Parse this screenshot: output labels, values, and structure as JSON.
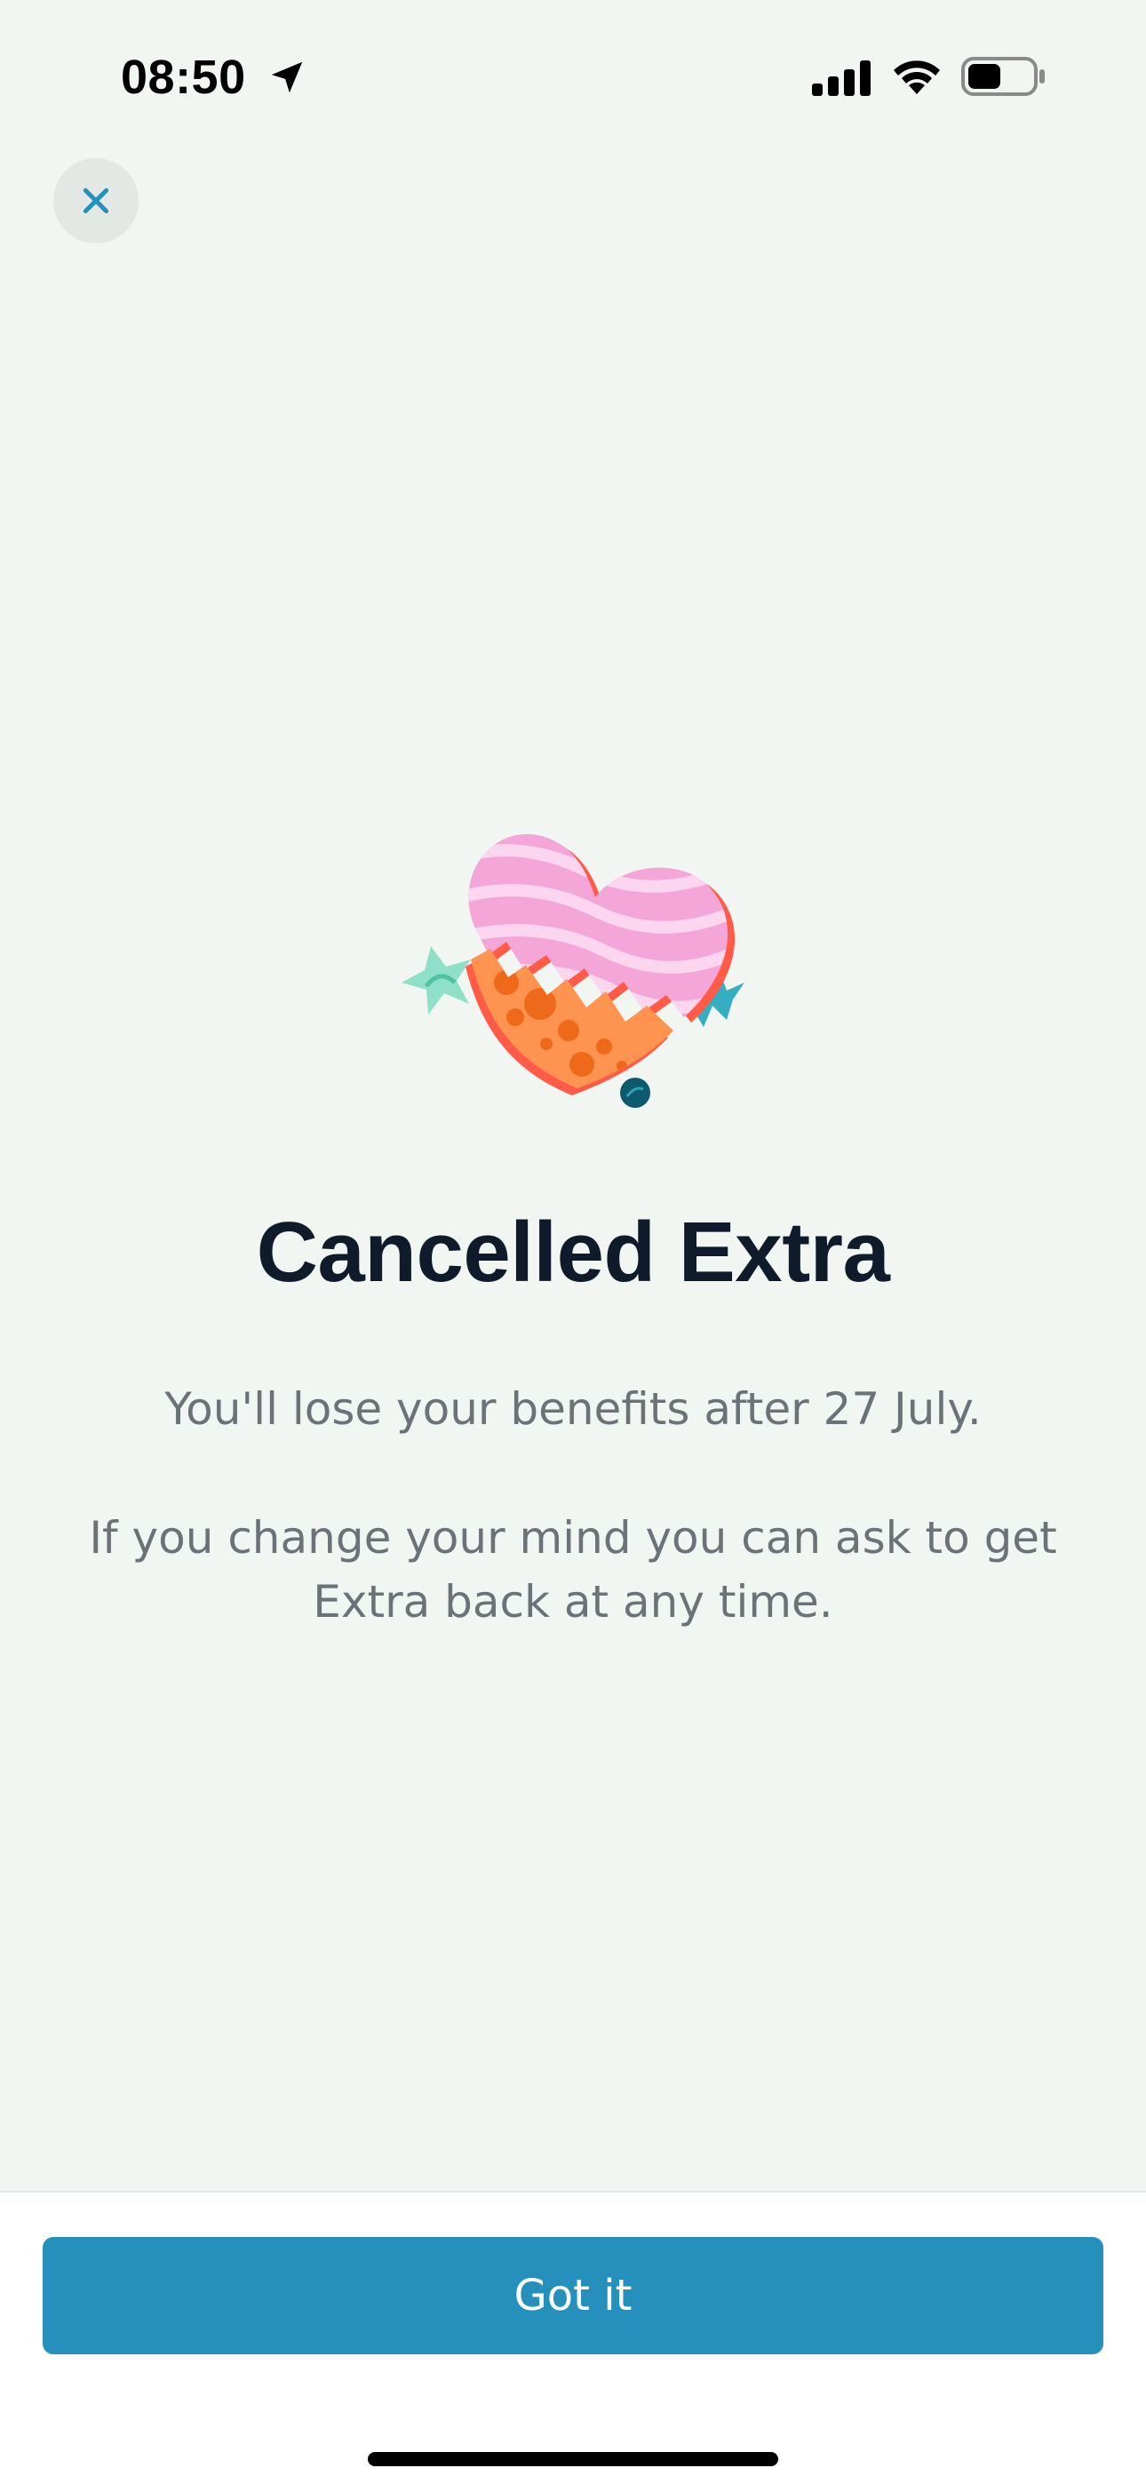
{
  "status_bar": {
    "time": "08:50",
    "icons": [
      "location-arrow-icon",
      "cellular-signal-icon",
      "wifi-icon",
      "battery-icon"
    ]
  },
  "close_button": {
    "icon": "close-icon"
  },
  "illustration": {
    "icon": "broken-heart-icon"
  },
  "content": {
    "title": "Cancelled Extra",
    "paragraph_1": "You'll lose your benefits after 27 July.",
    "paragraph_2": "If you change your mind you can ask to get Extra back at any time."
  },
  "footer": {
    "button_label": "Got it"
  },
  "colors": {
    "background": "#f2f6f2",
    "accent": "#2490bb",
    "title": "#0f1b2a",
    "body_text": "#6b7278"
  }
}
